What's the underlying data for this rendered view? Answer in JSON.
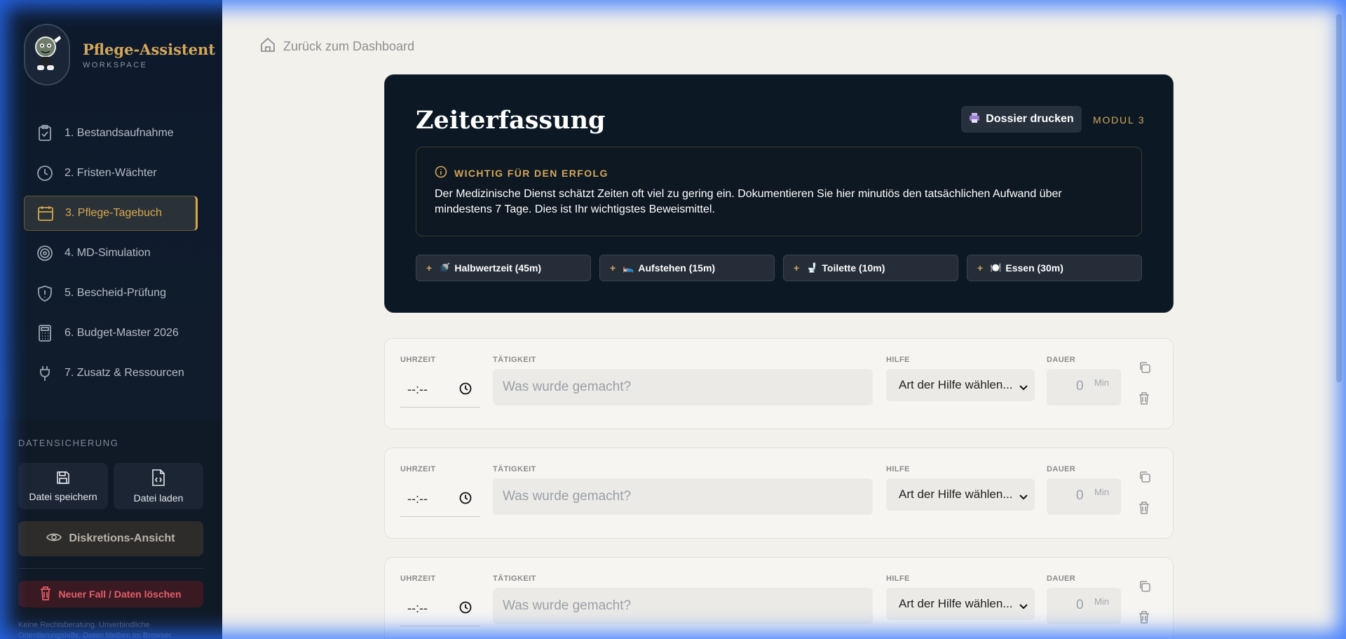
{
  "brand": {
    "title": "Pflege-Assistent",
    "subtitle": "WORKSPACE",
    "logo": "mascot-logo"
  },
  "nav": [
    {
      "label": "1. Bestandsaufnahme",
      "icon": "clipboard-check-icon"
    },
    {
      "label": "2. Fristen-Wächter",
      "icon": "clock-icon"
    },
    {
      "label": "3. Pflege-Tagebuch",
      "icon": "calendar-icon",
      "active": true
    },
    {
      "label": "4. MD-Simulation",
      "icon": "target-icon"
    },
    {
      "label": "5. Bescheid-Prüfung",
      "icon": "shield-alert-icon"
    },
    {
      "label": "6. Budget-Master 2026",
      "icon": "calculator-icon"
    },
    {
      "label": "7. Zusatz & Ressourcen",
      "icon": "plug-icon"
    }
  ],
  "backup": {
    "title": "DATENSICHERUNG",
    "save": "Datei speichern",
    "load": "Datei laden",
    "discretion": "Diskretions-Ansicht",
    "delete": "Neuer Fall / Daten löschen",
    "disclaimer": "Keine Rechtsberatung. Unverbindliche Orientierungshilfe. Daten bleiben im Browser."
  },
  "back_link": "Zurück zum Dashboard",
  "hero": {
    "title": "Zeiterfassung",
    "print": "Dossier drucken",
    "module": "MODUL 3",
    "notice_title": "WICHTIG FÜR DEN ERFOLG",
    "notice_text": "Der Medizinische Dienst schätzt Zeiten oft viel zu gering ein. Dokumentieren Sie hier minutiös den tatsächlichen Aufwand über mindestens 7 Tage. Dies ist Ihr wichtigstes Beweismittel.",
    "quick": [
      {
        "emoji": "🚿",
        "label": "Halbwertzeit (45m)"
      },
      {
        "emoji": "🛌",
        "label": "Aufstehen (15m)"
      },
      {
        "emoji": "🚽",
        "label": "Toilette (10m)"
      },
      {
        "emoji": "🍽️",
        "label": "Essen (30m)"
      }
    ]
  },
  "entry_labels": {
    "time": "UHRZEIT",
    "activity": "TÄTIGKEIT",
    "help": "HILFE",
    "duration": "DAUER"
  },
  "entries": [
    {
      "time": "--:--",
      "activity_placeholder": "Was wurde gemacht?",
      "help": "Art der Hilfe wählen...",
      "duration": "0",
      "unit": "Min"
    },
    {
      "time": "--:--",
      "activity_placeholder": "Was wurde gemacht?",
      "help": "Art der Hilfe wählen...",
      "duration": "0",
      "unit": "Min"
    },
    {
      "time": "--:--",
      "activity_placeholder": "Was wurde gemacht?",
      "help": "Art der Hilfe wählen...",
      "duration": "0",
      "unit": "Min"
    }
  ],
  "colors": {
    "accent": "#d4a75a",
    "sidebar": "#0d1a2b",
    "hero": "#0c1824",
    "danger": "#e35d6a",
    "glow": "#286eff"
  }
}
